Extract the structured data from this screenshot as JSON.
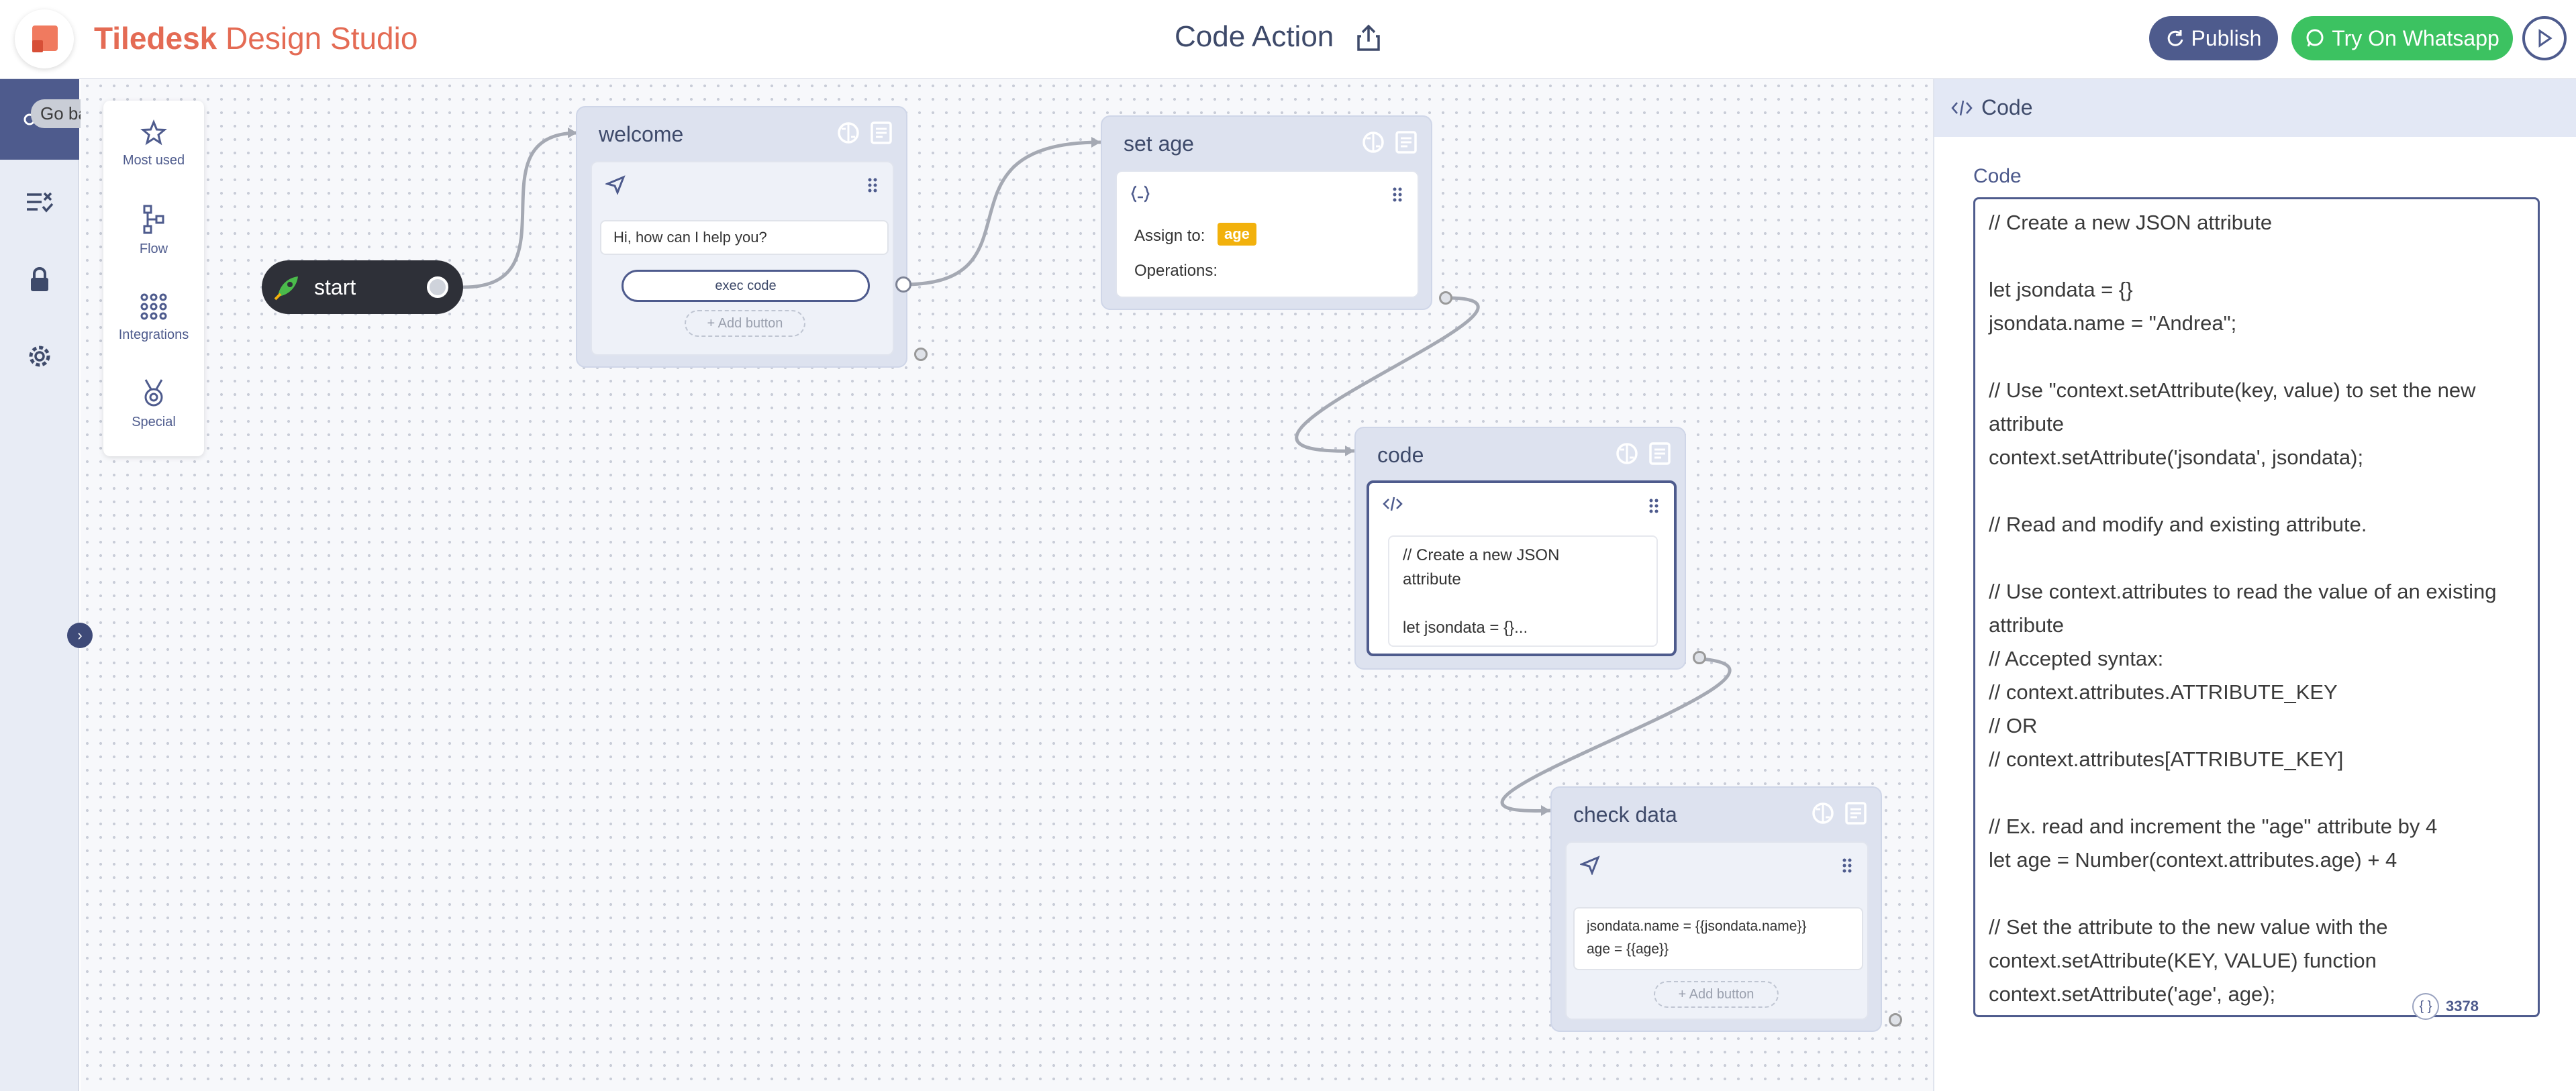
{
  "header": {
    "brand_bold": "Tiledesk",
    "brand_rest": " Design Studio",
    "page_title": "Code Action",
    "publish_label": "Publish",
    "whatsapp_label": "Try On Whatsapp"
  },
  "sidebar": {
    "tooltip": "Go back"
  },
  "palette": {
    "items": [
      {
        "label": "Most used",
        "icon": "star-icon"
      },
      {
        "label": "Flow",
        "icon": "flow-icon"
      },
      {
        "label": "Integrations",
        "icon": "integrations-icon"
      },
      {
        "label": "Special",
        "icon": "medal-icon"
      }
    ]
  },
  "canvas": {
    "start_label": "start",
    "blocks": {
      "welcome": {
        "title": "welcome",
        "message": "Hi, how can I help you?",
        "button": "exec code",
        "add_button": "+ Add button"
      },
      "set_age": {
        "title": "set age",
        "assign_label": "Assign to:",
        "assign_value": "age",
        "operations_label": "Operations:"
      },
      "code": {
        "title": "code",
        "preview_line1": "// Create a new JSON",
        "preview_line2": "attribute",
        "preview_line3": "let jsondata = {}..."
      },
      "check_data": {
        "title": "check data",
        "message_line1": "jsondata.name = {{jsondata.name}}",
        "message_line2": "age = {{age}}",
        "add_button": "+ Add button"
      }
    }
  },
  "panel": {
    "header": "Code",
    "field_label": "Code",
    "code_lines": [
      "// Create a new JSON attribute",
      "",
      "let jsondata = {}",
      "jsondata.name = \"Andrea\";",
      "",
      "// Use \"context.setAttribute(key, value) to set the new",
      "attribute",
      "context.setAttribute('jsondata', jsondata);",
      "",
      "// Read and modify and existing attribute.",
      "",
      "// Use context.attributes to read the value of an existing",
      "attribute",
      "// Accepted syntax:",
      "// context.attributes.ATTRIBUTE_KEY",
      "// OR",
      "// context.attributes[ATTRIBUTE_KEY]",
      "",
      "// Ex. read and increment the \"age\" attribute by 4",
      "let age = Number(context.attributes.age) + 4",
      "",
      "// Set the attribute to the new value with the",
      "context.setAttribute(KEY, VALUE) function",
      "context.setAttribute('age', age);"
    ],
    "char_count": "3378",
    "counter_icon": "{ }"
  },
  "colors": {
    "brand": "#e46b54",
    "primary": "#4e5b8d",
    "whatsapp": "#3cc261",
    "badge": "#f2b10c"
  }
}
